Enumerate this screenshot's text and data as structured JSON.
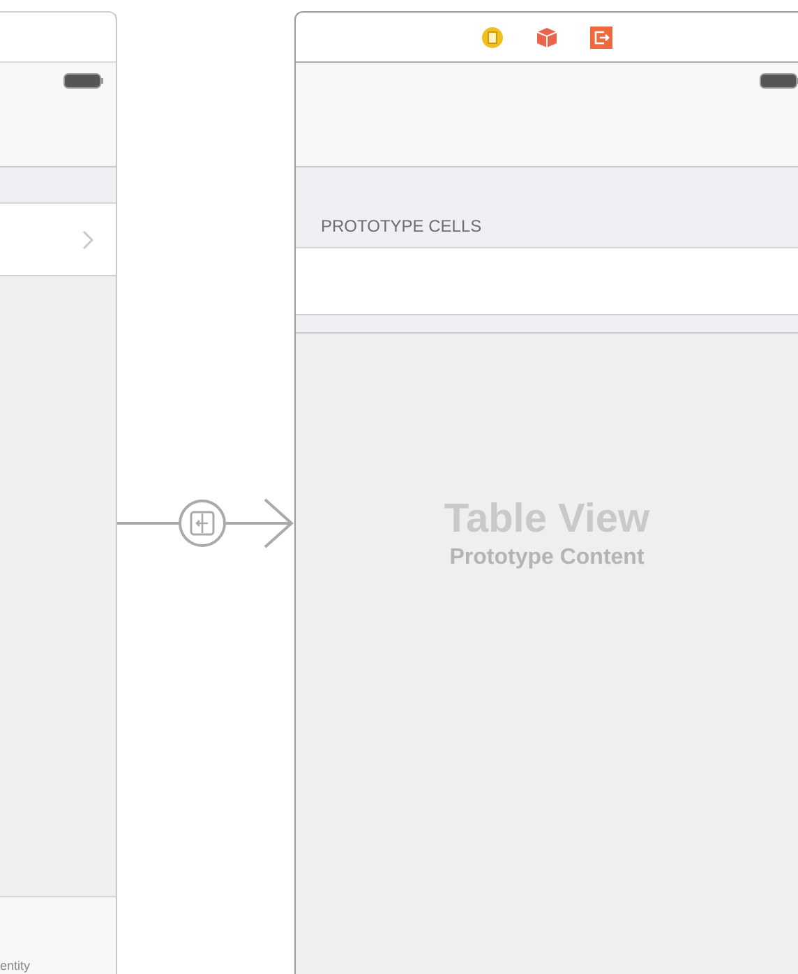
{
  "left_scene": {
    "footer_text": "entity"
  },
  "right_scene": {
    "section_header": "PROTOTYPE CELLS",
    "table_title": "Table View",
    "table_subtitle": "Prototype Content"
  }
}
